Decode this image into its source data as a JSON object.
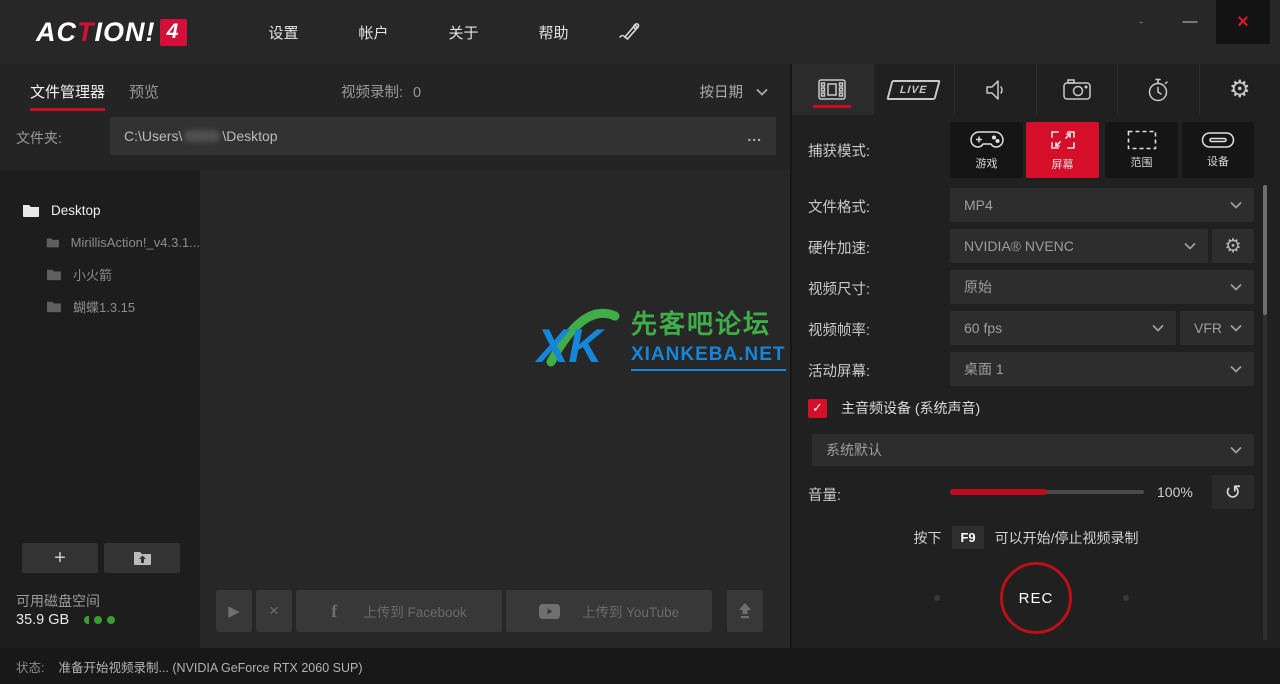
{
  "topbar": {
    "logo": {
      "part1": "AC",
      "accent": "T",
      "part2": "ION!",
      "badge": "4"
    },
    "menu": [
      "设置",
      "帐户",
      "关于",
      "帮助"
    ],
    "window_controls": {
      "tray": "-",
      "minimize": "—",
      "close": "×"
    }
  },
  "file_panel": {
    "tab_manager": "文件管理器",
    "tab_preview": "预览",
    "recordings_label": "视频录制:",
    "recordings_count": "0",
    "sort_label": "按日期",
    "folder_label": "文件夹:",
    "path_prefix": "C:\\Users\\",
    "path_suffix": "\\Desktop",
    "browse_label": "...",
    "tree": [
      {
        "name": "Desktop"
      },
      {
        "name": "MirillisAction!_v4.3.1..."
      },
      {
        "name": "小火箭"
      },
      {
        "name": "蝴蝶1.3.15"
      }
    ],
    "add_label": "+",
    "disk_label": "可用磁盘空间",
    "disk_value": "35.9 GB",
    "toolbar": {
      "play_glyph": "▶",
      "delete_glyph": "×",
      "facebook_glyph": "f",
      "upload_facebook": "上传到 Facebook",
      "upload_youtube": "上传到 YouTube"
    }
  },
  "watermark": {
    "mark": "XK",
    "title": "先客吧论坛",
    "site": "XIANKEBA.NET",
    "green": "#3fae49",
    "blue": "#1686d8"
  },
  "recording_panel": {
    "live_tab_label": "LIVE",
    "capture_label": "捕获模式:",
    "capture_modes": [
      {
        "label": "游戏",
        "active": false
      },
      {
        "label": "屏幕",
        "active": true
      },
      {
        "label": "范围",
        "active": false
      },
      {
        "label": "设备",
        "active": false
      }
    ],
    "settings": [
      {
        "label": "文件格式:",
        "value": "MP4"
      },
      {
        "label": "硬件加速:",
        "value": "NVIDIA® NVENC"
      },
      {
        "label": "视频尺寸:",
        "value": "原始"
      },
      {
        "label": "视频帧率:",
        "value": "60 fps",
        "value2": "VFR"
      },
      {
        "label": "活动屏幕:",
        "value": "桌面 1"
      }
    ],
    "audio": {
      "check_glyph": "✓",
      "enabled_label": "主音频设备 (系统声音)",
      "device": "系统默认",
      "volume_label": "音量:",
      "volume_percent": "100%",
      "volume_fill_ratio": 0.5,
      "reset_glyph": "↺"
    },
    "hotkey": {
      "press": "按下",
      "key": "F9",
      "action": "可以开始/停止视频录制"
    },
    "rec_label": "REC"
  },
  "status_bar": {
    "label": "状态:",
    "message": "准备开始视频录制...  (NVIDIA GeForce RTX 2060 SUP)"
  },
  "icons": {
    "gear": "⚙"
  },
  "colors": {
    "accent_red": "#d30f3a",
    "active_red": "#d50f2a",
    "disk_green": "#3a9e2f"
  }
}
